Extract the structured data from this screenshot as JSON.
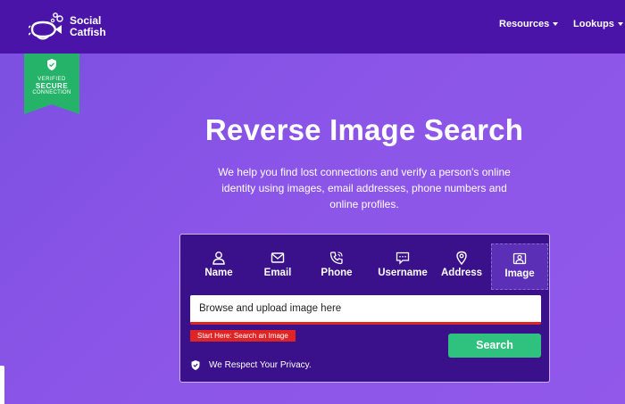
{
  "header": {
    "logo_line1": "Social",
    "logo_line2": "Catfish",
    "nav": [
      {
        "label": "Resources"
      },
      {
        "label": "Lookups"
      }
    ]
  },
  "badge": {
    "line1": "VERIFIED",
    "line2": "SECURE",
    "line3": "CONNECTION",
    "color": "#25b36a"
  },
  "hero": {
    "title": "Reverse Image Search",
    "subtitle": "We help you find lost connections and verify a person's online identity using images, email addresses, phone numbers and online profiles."
  },
  "search": {
    "tabs": [
      {
        "label": "Name",
        "icon": "person-icon"
      },
      {
        "label": "Email",
        "icon": "envelope-icon"
      },
      {
        "label": "Phone",
        "icon": "phone-icon"
      },
      {
        "label": "Username",
        "icon": "chat-icon"
      },
      {
        "label": "Address",
        "icon": "map-pin-icon"
      },
      {
        "label": "Image",
        "icon": "image-icon",
        "active": true
      }
    ],
    "input_text": "Browse and upload image here",
    "hint": "Start Here: Search an Image",
    "button_label": "Search",
    "privacy": "We Respect Your Privacy."
  },
  "colors": {
    "topbar": "#4a14a8",
    "card": "#3a118a",
    "accent_green": "#2ec27e",
    "alert_red": "#e02424"
  }
}
